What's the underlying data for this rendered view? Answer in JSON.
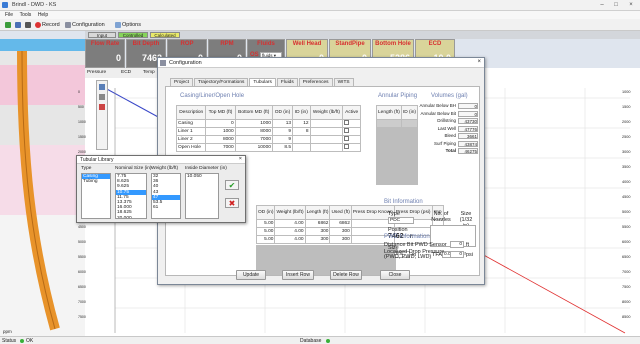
{
  "window": {
    "title": "Brindl - DWD - KS",
    "min": "–",
    "max": "□",
    "close": "×"
  },
  "menu": [
    "File",
    "Tools",
    "Help"
  ],
  "toolbar": {
    "record": "Record",
    "configuration": "Configuration",
    "options": "Options"
  },
  "status_strip": [
    {
      "label": "Input",
      "color": "#d8d8d8"
    },
    {
      "label": "Controlled",
      "color": "#86d35a"
    },
    {
      "label": "Calculated",
      "color": "#e9ea6a"
    }
  ],
  "readouts": [
    {
      "label": "Flow Rate",
      "value": "0"
    },
    {
      "label": "Bit Depth",
      "value": "7462"
    },
    {
      "label": "ROP",
      "value": "0"
    },
    {
      "label": "RPM",
      "value": "0"
    },
    {
      "label": "Fluids",
      "value": "OS",
      "extra": "fluids ▾"
    },
    {
      "label": "Well Head",
      "value": "0"
    },
    {
      "label": "StandPipe",
      "value": "0"
    },
    {
      "label": "Bottom Hole",
      "value": "5286"
    },
    {
      "label": "ECD",
      "value": "10.0"
    }
  ],
  "plot_tabs": [
    "Pressure",
    "ECD",
    "Temp"
  ],
  "left_axis": [
    "0",
    "500",
    "1000",
    "1500",
    "2000",
    "2500",
    "3000",
    "3500",
    "4000",
    "4500",
    "5000",
    "5500",
    "6000",
    "6500",
    "7000",
    "7500",
    "8000"
  ],
  "main_axis": [
    "1000",
    "1500",
    "2000",
    "2500",
    "3000",
    "3500",
    "4000",
    "4500",
    "5000",
    "5500",
    "6000",
    "6500",
    "7000",
    "7500",
    "8000",
    "8500",
    "9000",
    "9500",
    "10000"
  ],
  "left_legend": [
    "Casing",
    "Liner",
    "Bore",
    "Bit"
  ],
  "left_unit": "ppm",
  "config": {
    "title": "Configuration",
    "tabs": [
      "Project",
      "Trajectory/Formations",
      "Tubulars",
      "Fluids",
      "Preferences",
      "WITS"
    ],
    "active_tab": "Tubulars",
    "casing_header": "Casing/Liner/Open Hole",
    "casing_cols": [
      "Description",
      "Top MD (ft)",
      "Bottom MD (ft)",
      "OD (in)",
      "ID (in)",
      "Weight (lb/ft)",
      "Active"
    ],
    "casing_rows": [
      [
        "Casing",
        "0",
        "1000",
        "13",
        "12",
        ""
      ],
      [
        "Liner 1",
        "1000",
        "8000",
        "9",
        "8",
        ""
      ],
      [
        "Liner 2",
        "8000",
        "7000",
        "9",
        "",
        ""
      ],
      [
        "Open Hole",
        "7000",
        "10000",
        "8.5",
        "",
        ""
      ]
    ],
    "annular_header": "Annular Piping",
    "annular_cols": [
      "Length (ft)",
      "ID (in)"
    ],
    "volumes_header": "Volumes (gal)",
    "volumes": [
      {
        "label": "Annular Below BH",
        "value": "0"
      },
      {
        "label": "Annular Below Bit",
        "value": "0"
      },
      {
        "label": "Drillstring",
        "value": "43730"
      },
      {
        "label": "Last Well",
        "value": "47776"
      },
      {
        "label": "Bleed",
        "value": "3661"
      },
      {
        "label": "Surf Piping",
        "value": "43874"
      },
      {
        "label": "Total",
        "value": "46275"
      }
    ],
    "string_cols": [
      "OD (in)",
      "Weight (lb/ft)",
      "Length (ft)",
      "Used (ft)",
      "Press Drop Known",
      "Press Drop (psi)",
      "Imp"
    ],
    "string_rows": [
      [
        "5.00",
        "4.00",
        "6862",
        "6862"
      ],
      [
        "5.00",
        "4.00",
        "300",
        "300"
      ],
      [
        "5.00",
        "4.00",
        "300",
        "300"
      ]
    ],
    "bit_header": "Bit Information",
    "bit_type_label": "Type",
    "bit_type": "PDC",
    "bit_nozzles_label": "No. of Nozzles",
    "bit_size_label": "Size (1/32 in)",
    "bit_depth_label": "Position",
    "bit_depth": "7462",
    "bit_unit": "ft",
    "bit_size2_label": "Size",
    "bit_size2": "8.5",
    "bit_size2_unit": "in",
    "tfa_label": "TFA",
    "tfa_value": "0.0",
    "tfa_unit": "in²",
    "pwd_header": "PWD Information",
    "pwd_dist_label": "Distance Bit PWD Sensor",
    "pwd_dist": "0",
    "pwd_dist_unit": "ft",
    "pwd_drop_label": "Localized Drop Pressure (PWD, PWD, LWD)",
    "pwd_drop": "0",
    "pwd_drop_unit": "psi",
    "buttons": {
      "update": "Update",
      "insert": "Insert Row",
      "delete": "Delete Row",
      "close": "Close"
    }
  },
  "library": {
    "title": "Tubular Library",
    "cols": [
      "Type",
      "Nominal Size (in)",
      "Weight (lb/ft)",
      "Inside Diameter (in)"
    ],
    "types": [
      "Casing",
      "Tubing"
    ],
    "sizes": [
      "7.75",
      "8.625",
      "9.625",
      "10.75",
      "11.75",
      "13.375",
      "16.000",
      "18.625",
      "20.000"
    ],
    "weights": [
      "32",
      "36",
      "40",
      "43",
      "47",
      "53.5",
      "61"
    ],
    "ids": [
      "10.050"
    ]
  },
  "statusbar": {
    "status_label": "Status",
    "status_value": "OK",
    "db_label": "Database"
  }
}
